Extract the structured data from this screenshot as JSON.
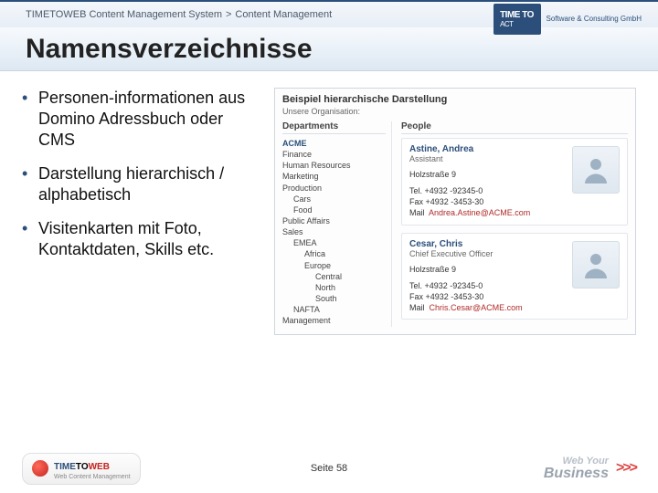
{
  "breadcrumb": {
    "product": "TIMETOWEB Content Management System",
    "sep": ">",
    "section": "Content Management"
  },
  "top_logo": {
    "line1": "TIME TO",
    "line2": "ACT",
    "sub": "Software & Consulting GmbH"
  },
  "title": "Namensverzeichnisse",
  "bullets": [
    "Personen-informationen aus Domino Adressbuch oder CMS",
    "Darstellung hierarchisch / alphabetisch",
    "Visitenkarten mit Foto, Kontaktdaten, Skills etc."
  ],
  "example": {
    "title": "Beispiel hierarchische Darstellung",
    "sub": "Unsere Organisation:",
    "dept_head": "Departments",
    "people_head": "People",
    "departments": {
      "root": "ACME",
      "level1": [
        "Finance",
        "Human Resources",
        "Marketing",
        "Production",
        "Public Affairs",
        "Sales"
      ],
      "prod_children": [
        "Cars",
        "Food"
      ],
      "sales_children": [
        "EMEA",
        "NAFTA"
      ],
      "emea_children": [
        "Africa",
        "Europe"
      ],
      "europe_children": [
        "Central",
        "North",
        "South"
      ],
      "last": "Management"
    },
    "people": [
      {
        "name": "Astine, Andrea",
        "role": "Assistant",
        "addr": "Holzstraße 9",
        "tel": "Tel.  +4932 -92345-0",
        "fax": "Fax  +4932 -3453-30",
        "mail_label": "Mail",
        "mail": "Andrea.Astine@ACME.com"
      },
      {
        "name": "Cesar, Chris",
        "role": "Chief Executive Officer",
        "addr": "Holzstraße 9",
        "tel": "Tel.  +4932 -92345-0",
        "fax": "Fax  +4932 -3453-30",
        "mail_label": "Mail",
        "mail": "Chris.Cesar@ACME.com"
      }
    ]
  },
  "footer": {
    "left": {
      "time": "TIME",
      "to": "TO",
      "web": "WEB",
      "sub": "Web Content Management"
    },
    "page_label": "Seite 58",
    "right": {
      "line1": "Web Your",
      "line2": "Business",
      "chevrons": ">>>"
    }
  }
}
